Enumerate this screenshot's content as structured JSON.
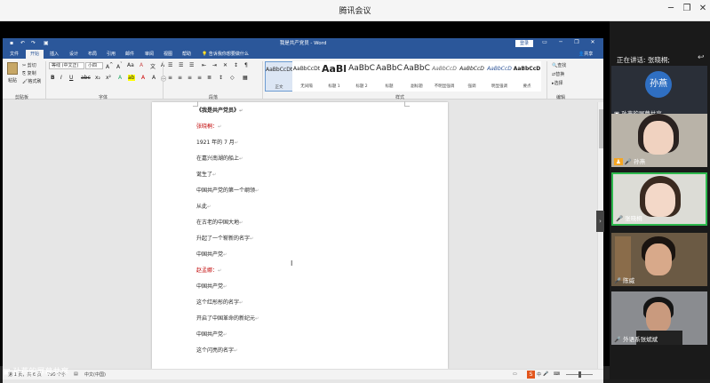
{
  "meeting": {
    "title": "腾讯会议",
    "share_label": "孙燕的屏幕共享",
    "speaking_label": "正在讲话: 张晓桐;"
  },
  "word": {
    "doc_title": "我是共产党员 - Word",
    "login_label": "登录",
    "tabs": [
      "文件",
      "开始",
      "插入",
      "设计",
      "布局",
      "引用",
      "邮件",
      "审阅",
      "视图",
      "帮助",
      "告诉我你想要做什么"
    ],
    "share_label": "共享",
    "ribbon": {
      "paste_label": "粘贴",
      "cut_label": "剪切",
      "copy_label": "复制",
      "format_painter_label": "格式刷",
      "font_name": "等线 (中文正)",
      "font_size": "小四",
      "groups": [
        "剪贴板",
        "字体",
        "段落",
        "样式",
        "编辑"
      ],
      "styles": [
        {
          "preview": "AaBbCcDt",
          "name": "正文"
        },
        {
          "preview": "AaBbCcDt",
          "name": "无间隔"
        },
        {
          "preview": "AaBl",
          "name": "标题 1"
        },
        {
          "preview": "AaBbC",
          "name": "标题 2"
        },
        {
          "preview": "AaBbC",
          "name": "标题"
        },
        {
          "preview": "AaBbC",
          "name": "副标题"
        },
        {
          "preview": "AaBbCcD",
          "name": "不明显强调"
        },
        {
          "preview": "AaBbCcD",
          "name": "强调"
        },
        {
          "preview": "AaBbCcD",
          "name": "明显强调"
        },
        {
          "preview": "AaBbCcD",
          "name": "要点"
        }
      ],
      "find_label": "查找",
      "replace_label": "替换",
      "select_label": "选择"
    },
    "document_lines": [
      {
        "text": "《我是共产党员》",
        "style": "bold"
      },
      {
        "text": "张晓桐：",
        "style": "red"
      },
      {
        "text": "1921 年的 7 月",
        "style": "normal"
      },
      {
        "text": "在嘉兴南湖的船上",
        "style": "normal"
      },
      {
        "text": "诞生了",
        "style": "normal"
      },
      {
        "text": "中国共产党的第一个纲领",
        "style": "normal"
      },
      {
        "text": "从此",
        "style": "normal"
      },
      {
        "text": "在古老的中国大地",
        "style": "normal"
      },
      {
        "text": "升起了一个崭新的名字",
        "style": "normal"
      },
      {
        "text": "中国共产党",
        "style": "normal"
      },
      {
        "text": "赵孟娜：",
        "style": "red"
      },
      {
        "text": "中国共产党",
        "style": "normal"
      },
      {
        "text": "这个红彤彤的名字",
        "style": "normal"
      },
      {
        "text": "开启了中国革命的新纪元",
        "style": "normal"
      },
      {
        "text": "中国共产党",
        "style": "normal"
      },
      {
        "text": "这个闪亮的名字",
        "style": "normal"
      }
    ],
    "status": {
      "page_info": "第 1 页，共 6 页",
      "word_count": "790 个字",
      "language": "中文(中国)"
    }
  },
  "participants": [
    {
      "name": "孙燕的屏幕共享",
      "avatar_text": "孙燕",
      "type": "avatar"
    },
    {
      "name": "孙燕",
      "type": "video"
    },
    {
      "name": "张晓桐",
      "type": "video"
    },
    {
      "name": "陈威",
      "type": "video"
    },
    {
      "name": "外语系张斌斌",
      "type": "video"
    }
  ]
}
